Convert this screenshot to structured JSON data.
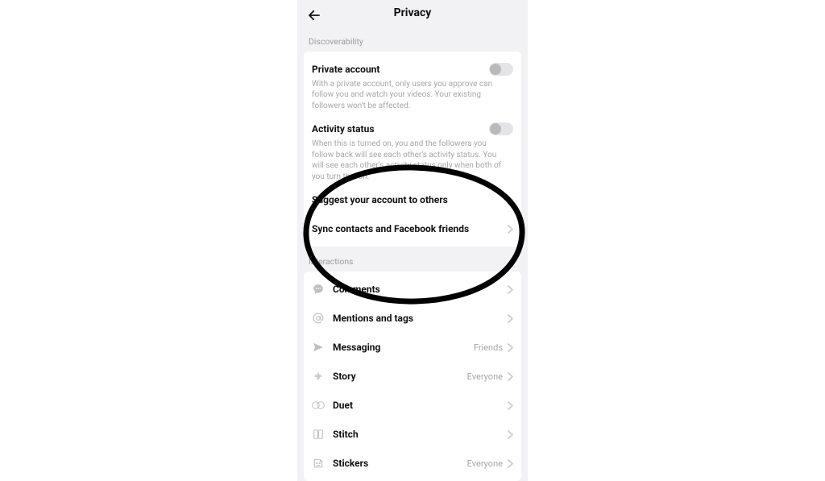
{
  "header": {
    "title": "Privacy"
  },
  "sections": {
    "discover_label": "Discoverability",
    "interactions_label": "Interactions"
  },
  "private_account": {
    "title": "Private account",
    "desc": "With a private account, only users you approve can follow you and watch your videos. Your existing followers won't be affected."
  },
  "activity_status": {
    "title": "Activity status",
    "desc": "When this is turned on, you and the followers you follow back will see each other's activity status. You will see each other's activity status only when both of you turn this on."
  },
  "suggest": {
    "label": "Suggest your account to others"
  },
  "sync": {
    "label": "Sync contacts and Facebook friends"
  },
  "interactions": {
    "comments": {
      "label": "Comments",
      "value": ""
    },
    "mentions": {
      "label": "Mentions and tags",
      "value": ""
    },
    "messaging": {
      "label": "Messaging",
      "value": "Friends"
    },
    "story": {
      "label": "Story",
      "value": "Everyone"
    },
    "duet": {
      "label": "Duet",
      "value": ""
    },
    "stitch": {
      "label": "Stitch",
      "value": ""
    },
    "stickers": {
      "label": "Stickers",
      "value": "Everyone"
    }
  }
}
